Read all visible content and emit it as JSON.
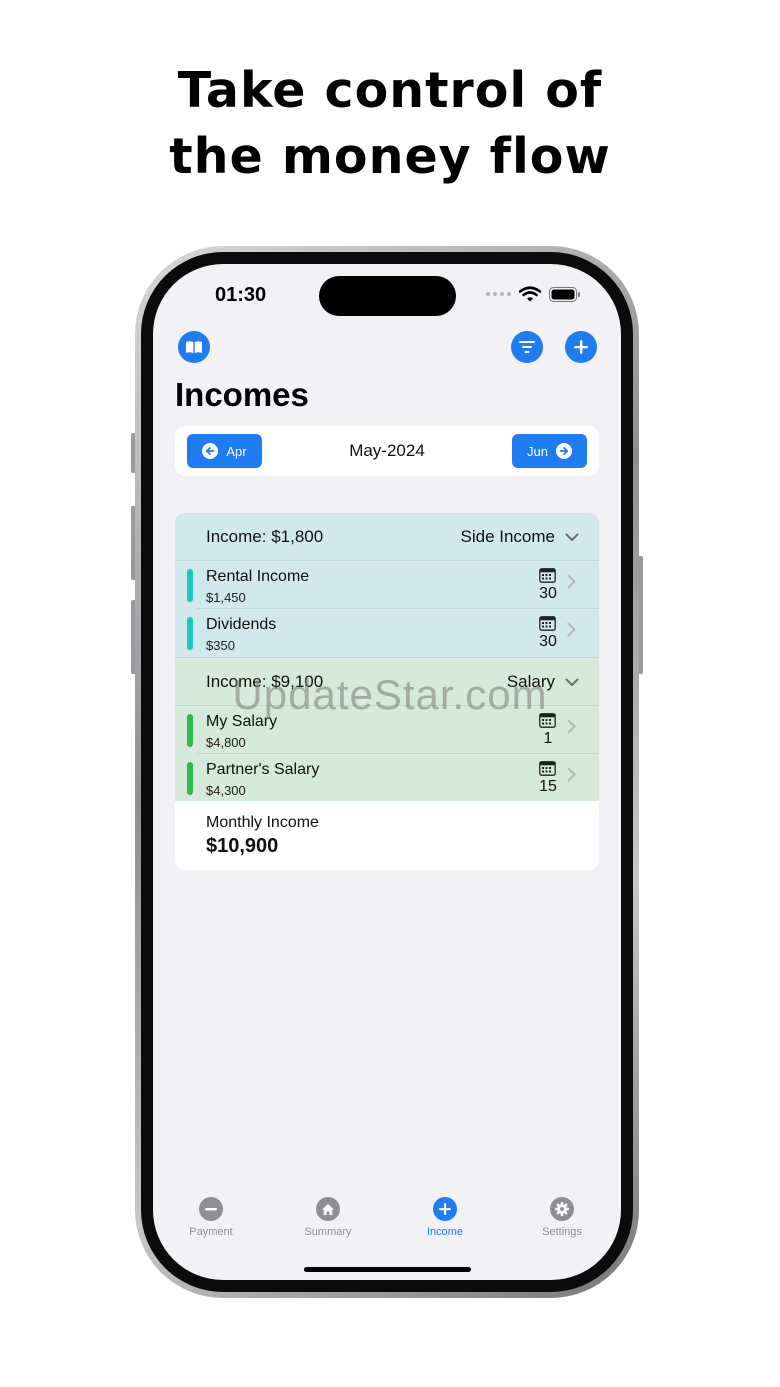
{
  "headline": {
    "line1": "Take control of",
    "line2": "the money flow"
  },
  "status": {
    "time": "01:30"
  },
  "toolbar": {
    "book_icon": "book-icon",
    "filter_icon": "filter-icon",
    "add_icon": "plus-icon"
  },
  "page": {
    "title": "Incomes"
  },
  "month_nav": {
    "prev": "Apr",
    "current": "May-2024",
    "next": "Jun"
  },
  "groups": [
    {
      "total": "Income: $1,800",
      "category": "Side Income",
      "color": "#cfe9ec",
      "bar_color": "#1ec7be",
      "items": [
        {
          "name": "Rental Income",
          "amount": "$1,450",
          "day": "30"
        },
        {
          "name": "Dividends",
          "amount": "$350",
          "day": "30"
        }
      ]
    },
    {
      "total": "Income: $9,100",
      "category": "Salary",
      "color": "#d6eadb",
      "bar_color": "#2fb94d",
      "items": [
        {
          "name": "My Salary",
          "amount": "$4,800",
          "day": "1"
        },
        {
          "name": "Partner's Salary",
          "amount": "$4,300",
          "day": "15"
        }
      ]
    }
  ],
  "summary": {
    "label": "Monthly Income",
    "value": "$10,900"
  },
  "watermark": "UpdateStar.com",
  "tabs": [
    {
      "label": "Payment",
      "icon": "minus-icon",
      "active": false
    },
    {
      "label": "Summary",
      "icon": "house-icon",
      "active": false
    },
    {
      "label": "Income",
      "icon": "plus-icon",
      "active": true
    },
    {
      "label": "Settings",
      "icon": "gear-icon",
      "active": false
    }
  ],
  "colors": {
    "accent": "#1f7cf3",
    "inactive": "#8e8e93",
    "background": "#f1f1f6"
  }
}
